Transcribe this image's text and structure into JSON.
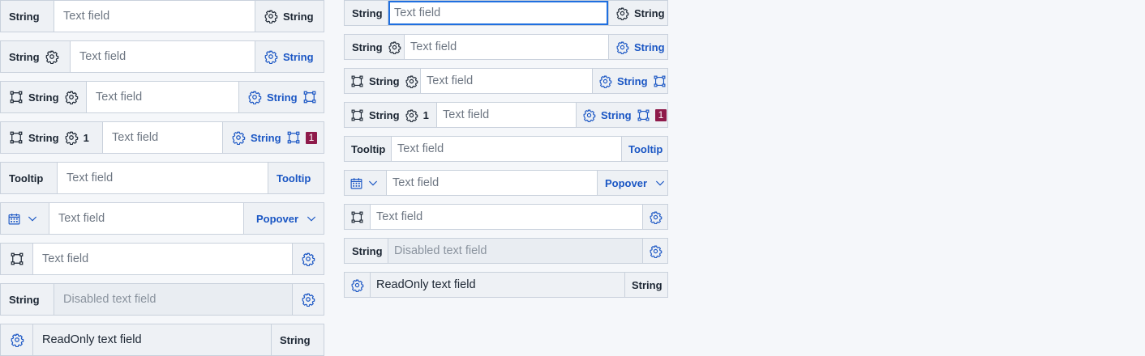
{
  "labels": {
    "string": "String",
    "tooltip": "Tooltip",
    "popover": "Popover",
    "count": "1"
  },
  "placeholders": {
    "text": "Text field",
    "disabled": "Disabled text field",
    "readonly": "ReadOnly text field"
  },
  "colors": {
    "accent": "#1a56c4",
    "focus": "#1f6fe0",
    "badge": "#8e1a4a"
  },
  "icons": [
    "gear-icon",
    "frame-icon",
    "calendar-icon",
    "chevron-down-icon"
  ]
}
